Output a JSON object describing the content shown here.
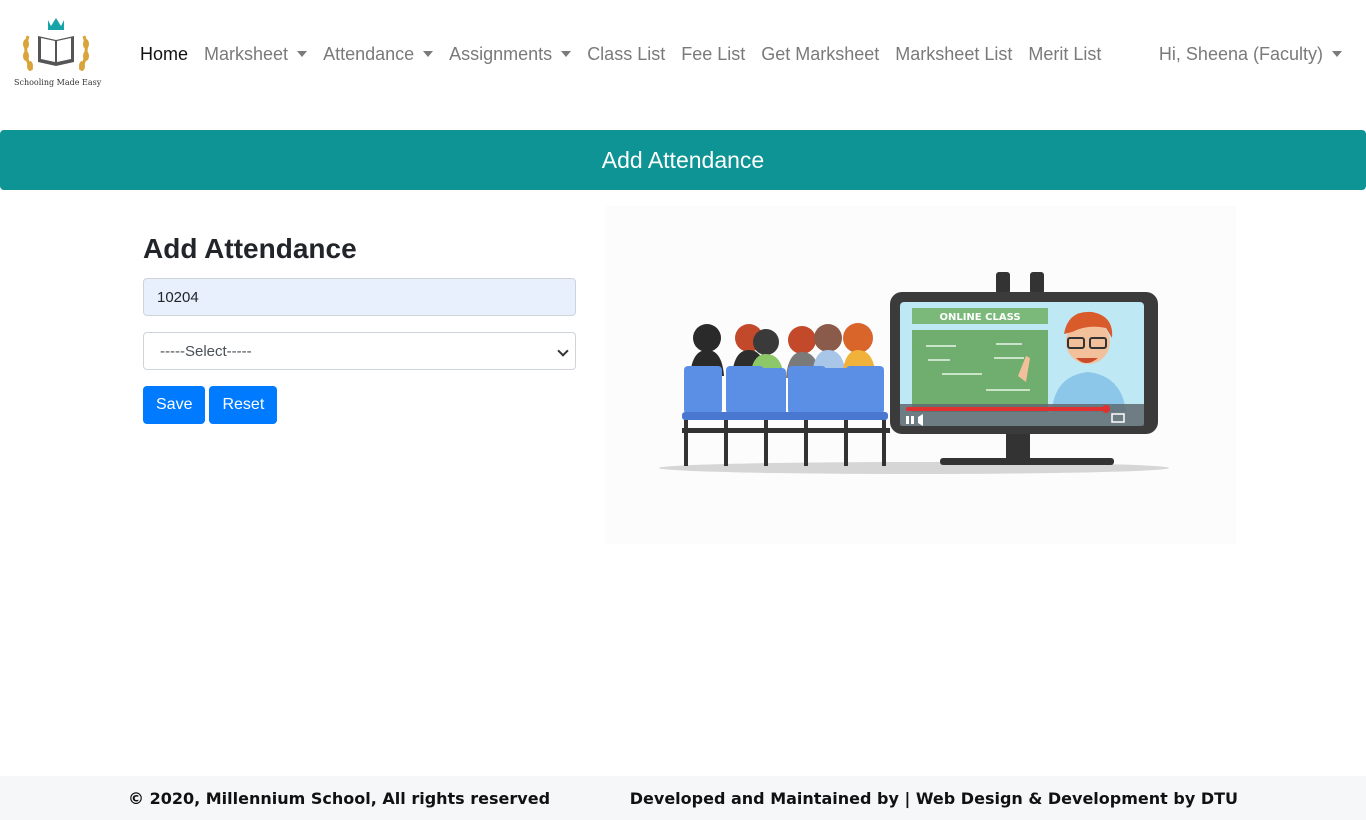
{
  "brand": {
    "logo_caption": "Schooling Made Easy"
  },
  "nav": {
    "items": [
      {
        "label": "Home",
        "active": true,
        "dropdown": false
      },
      {
        "label": "Marksheet",
        "active": false,
        "dropdown": true
      },
      {
        "label": "Attendance",
        "active": false,
        "dropdown": true
      },
      {
        "label": "Assignments",
        "active": false,
        "dropdown": true
      },
      {
        "label": "Class List",
        "active": false,
        "dropdown": false
      },
      {
        "label": "Fee List",
        "active": false,
        "dropdown": false
      },
      {
        "label": "Get Marksheet",
        "active": false,
        "dropdown": false
      },
      {
        "label": "Marksheet List",
        "active": false,
        "dropdown": false
      },
      {
        "label": "Merit List",
        "active": false,
        "dropdown": false
      }
    ],
    "user_label": "Hi, Sheena (Faculty)"
  },
  "banner": {
    "title": "Add Attendance"
  },
  "form": {
    "title": "Add Attendance",
    "id_value": "10204",
    "select_value": "-----Select-----",
    "save_label": "Save",
    "reset_label": "Reset"
  },
  "illustration": {
    "screen_label": "ONLINE CLASS"
  },
  "footer": {
    "left": "© 2020, Millennium School, All rights reserved",
    "right": "Developed and Maintained by | Web Design & Development by DTU"
  },
  "colors": {
    "accent": "#0e9494",
    "primary_button": "#007bff",
    "input_autofill": "#e8f0fe"
  }
}
